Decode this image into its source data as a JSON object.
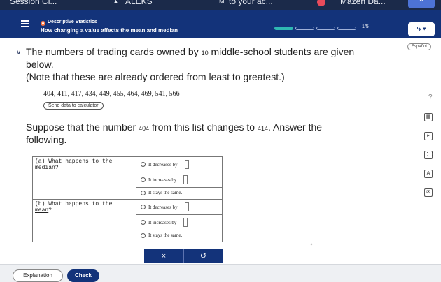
{
  "browser_tabs": [
    {
      "label": "Session Cl..."
    },
    {
      "label": "ALEKS"
    },
    {
      "label": "to your ac..."
    },
    {
      "label": "Mazen Da..."
    }
  ],
  "header": {
    "topic_label": "Descriptive Statistics",
    "lesson_title": "How changing a value affects the mean and median",
    "progress_text": "1/5",
    "progress_segments": 5,
    "progress_filled": 1,
    "colors": {
      "bar": "#13337a",
      "accent": "#2fb8b2",
      "topic_dot": "#ff7a45"
    }
  },
  "language_button": "Español",
  "question": {
    "line1_a": "The numbers of trading cards owned by ",
    "line1_num": "10",
    "line1_b": " middle-school students are given",
    "line2": "below.",
    "line3": "(Note that these are already ordered from least to greatest.)",
    "data_list": "404, 411, 417, 434, 449, 455, 464, 469, 541, 566",
    "calculator_button": "Send data to calculator",
    "change_a": "Suppose that the number ",
    "change_num1": "404",
    "change_b": " from this list changes to ",
    "change_num2": "414",
    "change_c": ". Answer the",
    "change_line2": "following."
  },
  "table": {
    "part_a_label_1": "(a)  What happens to the",
    "part_a_label_2": "median",
    "part_a_label_q": "?",
    "part_b_label_1": "(b)  What happens to the",
    "part_b_label_2": "mean",
    "part_b_label_q": "?",
    "option_decrease": "It decreases by",
    "option_increase": "It increases by",
    "option_same": "It stays the same."
  },
  "controls": {
    "clear_label": "×",
    "undo_label": "↺"
  },
  "side_tools": {
    "help_label": "?"
  },
  "footer": {
    "explanation_label": "Explanation",
    "check_label": "Check"
  }
}
